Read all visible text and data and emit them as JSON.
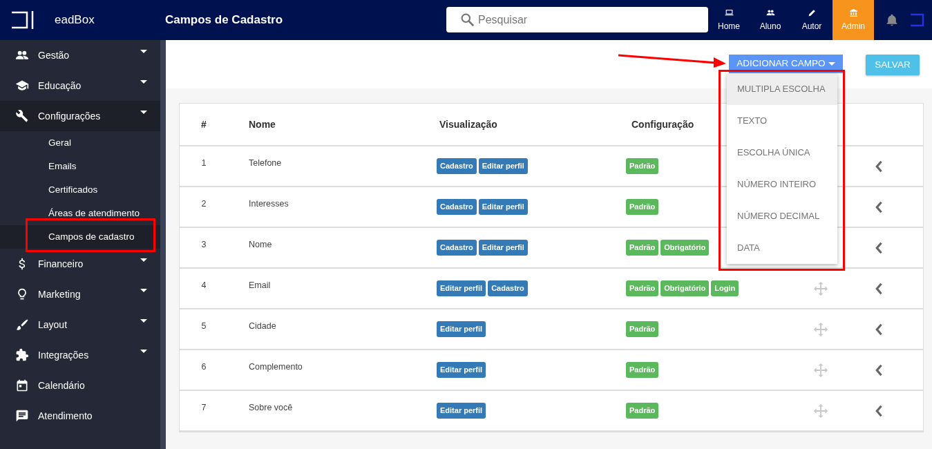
{
  "navbar": {
    "brand": "eadBox",
    "page_title": "Campos de Cadastro",
    "search": {
      "placeholder": "Pesquisar"
    },
    "links": [
      {
        "label": "Home",
        "selected": false
      },
      {
        "label": "Aluno",
        "selected": false
      },
      {
        "label": "Autor",
        "selected": false
      },
      {
        "label": "Admin",
        "selected": true
      }
    ]
  },
  "sidebar": {
    "items": [
      {
        "label": "Gestão",
        "expanded": false,
        "has_children": true
      },
      {
        "label": "Educação",
        "expanded": false,
        "has_children": true
      },
      {
        "label": "Configurações",
        "expanded": true,
        "has_children": true,
        "children": [
          {
            "label": "Geral",
            "selected": false
          },
          {
            "label": "Emails",
            "selected": false
          },
          {
            "label": "Certificados",
            "selected": false
          },
          {
            "label": "Áreas de atendimento",
            "selected": false
          },
          {
            "label": "Campos de cadastro",
            "selected": true
          }
        ]
      },
      {
        "label": "Financeiro",
        "expanded": false,
        "has_children": true
      },
      {
        "label": "Marketing",
        "expanded": false,
        "has_children": true
      },
      {
        "label": "Layout",
        "expanded": false,
        "has_children": true
      },
      {
        "label": "Integrações",
        "expanded": false,
        "has_children": true
      },
      {
        "label": "Calendário",
        "expanded": false,
        "has_children": false
      },
      {
        "label": "Atendimento",
        "expanded": false,
        "has_children": false
      }
    ]
  },
  "toolbar": {
    "add_button": {
      "label": "ADICIONAR CAMPO",
      "expanded": true
    },
    "save_button": {
      "label": "SALVAR"
    }
  },
  "dropdown": {
    "items": [
      {
        "label": "MULTIPLA ESCOLHA",
        "selected": true
      },
      {
        "label": "TEXTO",
        "selected": false
      },
      {
        "label": "ESCOLHA ÚNICA",
        "selected": false
      },
      {
        "label": "NÚMERO INTEIRO",
        "selected": false
      },
      {
        "label": "NÚMERO DECIMAL",
        "selected": false
      },
      {
        "label": "DATA",
        "selected": false
      }
    ]
  },
  "table": {
    "columns": [
      "#",
      "Nome",
      "Visualização",
      "Configuração"
    ],
    "rows": [
      {
        "number": "1",
        "name": "Telefone",
        "views": [
          "Cadastro",
          "Editar perfil"
        ],
        "config": [
          "Padrão"
        ],
        "drag_handle": false
      },
      {
        "number": "2",
        "name": "Interesses",
        "views": [
          "Cadastro",
          "Editar perfil"
        ],
        "config": [
          "Padrão"
        ],
        "drag_handle": false
      },
      {
        "number": "3",
        "name": "Nome",
        "views": [
          "Cadastro",
          "Editar perfil"
        ],
        "config": [
          "Padrão",
          "Obrigatório"
        ],
        "drag_handle": false
      },
      {
        "number": "4",
        "name": "Email",
        "views": [
          "Editar perfil",
          "Cadastro"
        ],
        "config": [
          "Padrão",
          "Obrigatório",
          "Login"
        ],
        "drag_handle": true
      },
      {
        "number": "5",
        "name": "Cidade",
        "views": [
          "Editar perfil"
        ],
        "config": [
          "Padrão"
        ],
        "drag_handle": true
      },
      {
        "number": "6",
        "name": "Complemento",
        "views": [
          "Editar perfil"
        ],
        "config": [
          "Padrão"
        ],
        "drag_handle": true
      },
      {
        "number": "7",
        "name": "Sobre você",
        "views": [
          "Editar perfil"
        ],
        "config": [
          "Padrão"
        ],
        "drag_handle": true
      }
    ]
  }
}
